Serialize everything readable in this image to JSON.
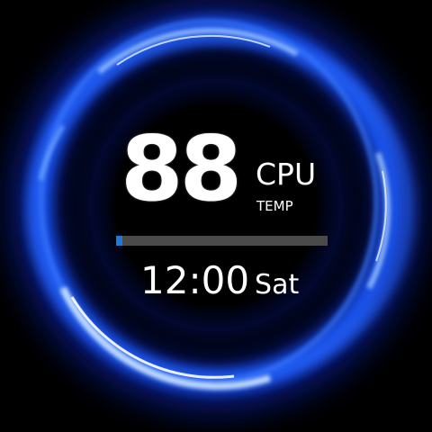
{
  "temperature": {
    "value": "88",
    "label_main": "CPU",
    "label_sub": "TEMP"
  },
  "progress": {
    "fraction": 0.03,
    "track_color": "#4a4a4a",
    "fill_color": "#1e7ad6"
  },
  "clock": {
    "time": "12:00",
    "day": "Sat"
  },
  "theme": {
    "background": "#000000",
    "ring_color": "#1f5cff",
    "ring_highlight": "#bfe0ff"
  }
}
